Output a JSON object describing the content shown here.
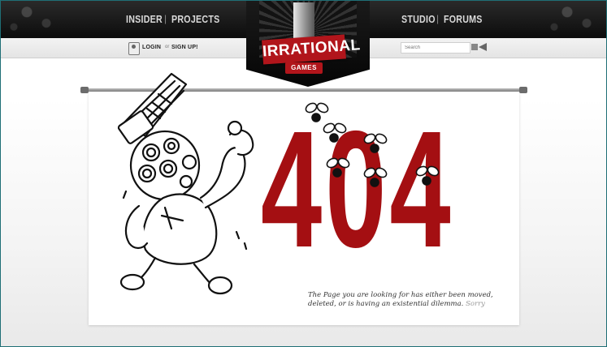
{
  "nav": {
    "left": [
      "INSIDER",
      "PROJECTS"
    ],
    "right": [
      "STUDIO",
      "FORUMS"
    ],
    "separator": "|"
  },
  "subbar": {
    "login_label": "LOGIN",
    "or_label": "or",
    "signup_label": "SIGN UP!",
    "search_placeholder": "Search"
  },
  "logo": {
    "title": "IRRATIONAL",
    "subtitle": "GAMES"
  },
  "error": {
    "code": "404",
    "message": "The Page you are looking for has either been moved, deleted, or is having an existential dilemma.",
    "sorry": "Sorry"
  },
  "colors": {
    "brand_red": "#a40f12",
    "nav_bg": "#111111"
  },
  "icons": {
    "login": "user-card-icon",
    "search": "search-arrow-icon",
    "illustration": "big-daddy-illustration",
    "bugs": "fly-bug-icon"
  }
}
